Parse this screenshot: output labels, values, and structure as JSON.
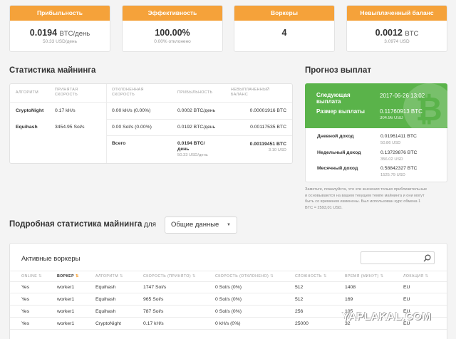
{
  "kpis": [
    {
      "title": "Прибыльность",
      "value": "0.0194",
      "unit": "BTC/день",
      "sub": "50.33 USD/день"
    },
    {
      "title": "Эффективность",
      "value": "100.00%",
      "unit": "",
      "sub": "0.00% отклонено"
    },
    {
      "title": "Воркеры",
      "value": "4",
      "unit": "",
      "sub": ""
    },
    {
      "title": "Невыплаченный баланс",
      "value": "0.0012",
      "unit": "BTC",
      "sub": "3.0974 USD"
    }
  ],
  "mining_stats": {
    "title": "Статистика майнинга",
    "headers": {
      "algorithm": "АЛГОРИТМ",
      "accepted": [
        "ПРИНЯТАЯ",
        "СКОРОСТЬ"
      ],
      "rejected": [
        "ОТКЛОНЕННАЯ",
        "СКОРОСТЬ"
      ],
      "profit": "ПРИБЫЛЬНОСТЬ",
      "unpaid": [
        "НЕВЫПЛАЧЕННЫЙ",
        "БАЛАНС"
      ]
    },
    "rows": [
      {
        "algorithm": "CryptoNight",
        "accepted": "0.17 kH/s",
        "rejected": "0.00 kH/s (0.00%)",
        "profit": "0.0002 BTC/день",
        "unpaid": "0.00001916 BTC"
      },
      {
        "algorithm": "Equihash",
        "accepted": "3454.95 Sol/s",
        "rejected": "0.00 Sol/s (0.00%)",
        "profit": "0.0192 BTC/день",
        "unpaid": "0.00117535 BTC"
      }
    ],
    "total": {
      "label": "Всего",
      "profit_1": "0.0194 BTC/",
      "profit_2": "день",
      "profit_usd": "50.33 USD/день",
      "unpaid": "0.00119451 BTC",
      "unpaid_usd": "3.10 USD"
    }
  },
  "forecast": {
    "title": "Прогноз выплат",
    "next_label_1": "Следующая",
    "next_label_2": "выплата",
    "next_value": "2017-06-26 13:02",
    "size_label": "Размер выплаты",
    "size_value": "0.11760913 BTC",
    "size_usd": "304.96 USD",
    "rows": [
      {
        "label": "Дневной доход",
        "value": "0.01961411 BTC",
        "usd": "50.86 USD"
      },
      {
        "label": "Недельный доход",
        "value": "0.13729876 BTC",
        "usd": "356.02 USD"
      },
      {
        "label": "Месячный доход",
        "value": "0.58842327 BTC",
        "usd": "1525.79 USD"
      }
    ],
    "note_lines": [
      "Заметьте, пожалуйста, что эти значения только приблизительные",
      "и основываются на вашем текущем темпе майнинга и они могут",
      "быть со временем изменены. Был использован курс обмена 1",
      "BTC = 2593,01 USD."
    ]
  },
  "detailed": {
    "title": "Подробная статистика майнинга",
    "for_label": "для",
    "select_value": "Общие данные",
    "panel_title": "Активные воркеры",
    "search_placeholder": "",
    "columns": [
      "ONLINE",
      "ВОРКЕР",
      "АЛГОРИТМ",
      "СКОРОСТЬ (ПРИНЯТО)",
      "СКОРОСТЬ (ОТКЛОНЕНО)",
      "СЛОЖНОСТЬ",
      "ВРЕМЯ (МИНУТ)",
      "ЛОКАЦИЯ"
    ],
    "rows": [
      [
        "Yes",
        "worker1",
        "Equihash",
        "1747 Sol/s",
        "0 Sol/s (0%)",
        "512",
        "1408",
        "EU"
      ],
      [
        "Yes",
        "worker1",
        "Equihash",
        "965 Sol/s",
        "0 Sol/s (0%)",
        "512",
        "169",
        "EU"
      ],
      [
        "Yes",
        "worker1",
        "Equihash",
        "787 Sol/s",
        "0 Sol/s (0%)",
        "256",
        "105",
        "EU"
      ],
      [
        "Yes",
        "worker1",
        "CryptoNight",
        "0.17 kH/s",
        "0 kH/s (0%)",
        "25000",
        "32",
        "EU"
      ]
    ]
  },
  "watermark": "YAPLAKAL.COM",
  "colors": {
    "accent": "#f5a23a",
    "forecast": "#5ab34a",
    "sort_active": "#f5a23a"
  }
}
